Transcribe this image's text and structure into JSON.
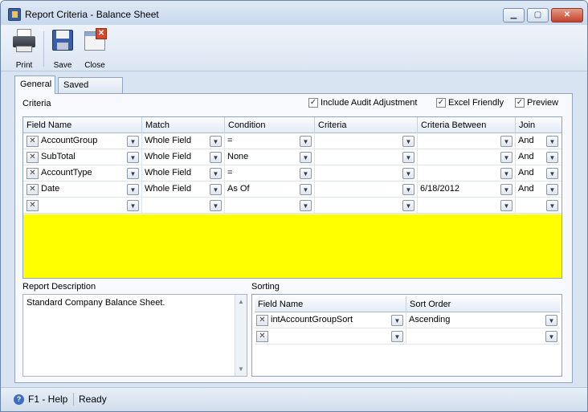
{
  "window": {
    "title": "Report Criteria - Balance Sheet",
    "controls": {
      "minimize": "▁",
      "maximize": "▢",
      "close": "✕"
    }
  },
  "toolbar": {
    "print_label": "Print",
    "save_label": "Save",
    "close_label": "Close"
  },
  "tabs": [
    {
      "label": "General",
      "active": true
    },
    {
      "label": "Saved Criteria",
      "active": false
    }
  ],
  "criteria": {
    "section_label": "Criteria",
    "options": [
      {
        "label": "Include Audit Adjustment",
        "checked": true
      },
      {
        "label": "Excel Friendly",
        "checked": true
      },
      {
        "label": "Preview",
        "checked": true
      }
    ],
    "columns": [
      "Field Name",
      "Match",
      "Condition",
      "Criteria",
      "Criteria Between",
      "Join"
    ],
    "rows": [
      {
        "field": "AccountGroup",
        "match": "Whole Field",
        "condition": "=",
        "criteria": "",
        "between": "",
        "join": "And"
      },
      {
        "field": "SubTotal",
        "match": "Whole Field",
        "condition": "None",
        "criteria": "",
        "between": "",
        "join": "And"
      },
      {
        "field": "AccountType",
        "match": "Whole Field",
        "condition": "=",
        "criteria": "",
        "between": "",
        "join": "And"
      },
      {
        "field": "Date",
        "match": "Whole Field",
        "condition": "As Of",
        "criteria": "",
        "between": "6/18/2012",
        "join": "And"
      },
      {
        "field": "",
        "match": "",
        "condition": "",
        "criteria": "",
        "between": "",
        "join": ""
      }
    ],
    "highlight_color": "#ffff00"
  },
  "report_description": {
    "label": "Report Description",
    "text": "Standard Company Balance Sheet."
  },
  "sorting": {
    "label": "Sorting",
    "columns": [
      "Field Name",
      "Sort Order"
    ],
    "rows": [
      {
        "field": "intAccountGroupSort",
        "order": "Ascending"
      },
      {
        "field": "",
        "order": ""
      }
    ]
  },
  "status": {
    "help": "F1 - Help",
    "state": "Ready"
  },
  "icons": {
    "remove": "✕",
    "dropdown": "▼",
    "check": "✓",
    "help": "?",
    "scroll_up": "▲",
    "scroll_down": "▼"
  }
}
